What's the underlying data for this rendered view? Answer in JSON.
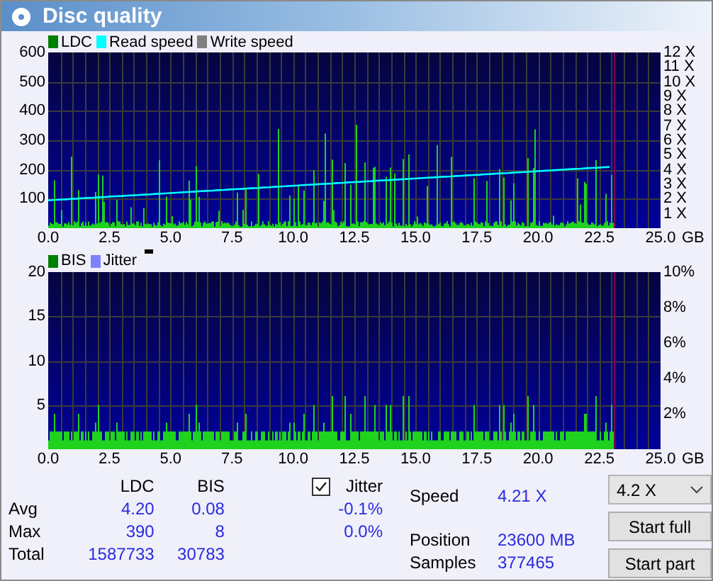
{
  "window": {
    "title": "Disc quality"
  },
  "ldc_chart": {
    "legend": [
      {
        "label": "LDC",
        "color": "#008000"
      },
      {
        "label": "Read speed",
        "color": "#00ffff"
      },
      {
        "label": "Write speed",
        "color": "#808080"
      }
    ],
    "y_ticks": [
      "600",
      "500",
      "400",
      "300",
      "200",
      "100"
    ],
    "y2_ticks": [
      "12 X",
      "11 X",
      "10 X",
      "9 X",
      "8 X",
      "7 X",
      "6 X",
      "5 X",
      "4 X",
      "3 X",
      "2 X",
      "1 X"
    ],
    "x_ticks": [
      "0.0",
      "2.5",
      "5.0",
      "7.5",
      "10.0",
      "12.5",
      "15.0",
      "17.5",
      "20.0",
      "22.5",
      "25.0"
    ],
    "x_unit": "GB"
  },
  "bis_chart": {
    "legend": [
      {
        "label": "BIS",
        "color": "#008000"
      },
      {
        "label": "Jitter",
        "color": "#8080ff"
      }
    ],
    "y_ticks": [
      "20",
      "15",
      "10",
      "5"
    ],
    "y2_ticks": [
      "10%",
      "8%",
      "6%",
      "4%",
      "2%"
    ],
    "x_ticks": [
      "0.0",
      "2.5",
      "5.0",
      "7.5",
      "10.0",
      "12.5",
      "15.0",
      "17.5",
      "20.0",
      "22.5",
      "25.0"
    ],
    "x_unit": "GB"
  },
  "stats": {
    "columns": [
      "LDC",
      "BIS"
    ],
    "rows": [
      {
        "label": "Avg",
        "ldc": "4.20",
        "bis": "0.08",
        "jitter": "-0.1%"
      },
      {
        "label": "Max",
        "ldc": "390",
        "bis": "8",
        "jitter": "0.0%"
      },
      {
        "label": "Total",
        "ldc": "1587733",
        "bis": "30783"
      }
    ]
  },
  "jitter": {
    "label": "Jitter",
    "checked": true
  },
  "info": [
    {
      "label": "Speed",
      "value": "4.21 X"
    },
    {
      "label": "Position",
      "value": "23600 MB"
    },
    {
      "label": "Samples",
      "value": "377465"
    }
  ],
  "speed_select": {
    "value": "4.2 X"
  },
  "buttons": [
    "Start full",
    "Start part"
  ]
}
